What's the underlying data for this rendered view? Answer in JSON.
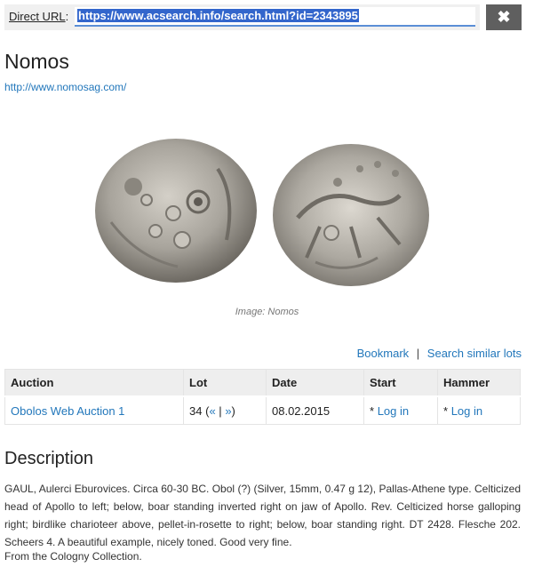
{
  "url_bar": {
    "label": "Direct URL",
    "value": "https://www.acsearch.info/search.html?id=2343895",
    "close_icon": "close-icon"
  },
  "auction_house": {
    "name": "Nomos",
    "website": "http://www.nomosag.com/"
  },
  "image": {
    "caption": "Image: Nomos",
    "coin_color": "#a09c94"
  },
  "actions": {
    "bookmark": "Bookmark",
    "separator": "|",
    "search_similar": "Search similar lots"
  },
  "lot_table": {
    "headers": [
      "Auction",
      "Lot",
      "Date",
      "Start",
      "Hammer"
    ],
    "row": {
      "auction": "Obolos Web Auction 1",
      "lot_number": "34",
      "lot_open": "(",
      "lot_prev": "«",
      "lot_sep": "|",
      "lot_next": "»",
      "lot_close": ")",
      "date": "08.02.2015",
      "start_prefix": "*",
      "start_link": "Log in",
      "hammer_prefix": "*",
      "hammer_link": "Log in"
    }
  },
  "description": {
    "heading": "Description",
    "text": "GAUL, Aulerci Eburovices. Circa 60-30 BC. Obol (?) (Silver, 15mm, 0.47 g 12), Pallas-Athene type. Celticized head of Apollo to left; below, boar standing inverted right on jaw of Apollo. Rev. Celticized horse galloping right; birdlike charioteer above, pellet-in-rosette to right; below, boar standing right. DT 2428. Flesche 202. Scheers 4. A beautiful example, nicely toned. Good very fine.",
    "provenance": "From the Cologny Collection."
  },
  "colors": {
    "link": "#2277bb",
    "selection": "#3366cc",
    "close_button": "#5f5f5f"
  }
}
